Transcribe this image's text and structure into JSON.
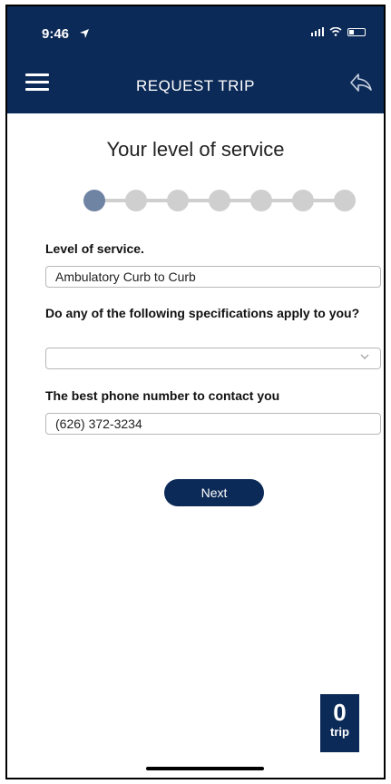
{
  "status_bar": {
    "time": "9:46"
  },
  "header": {
    "title": "REQUEST TRIP"
  },
  "page": {
    "heading": "Your level of service"
  },
  "stepper": {
    "total_steps": 7,
    "current_step": 1
  },
  "form": {
    "level_of_service_label": "Level of service.",
    "level_of_service_value": "Ambulatory Curb to Curb",
    "specifications_label": "Do any of the following specifications apply to you?",
    "specifications_value": "",
    "phone_label": "The best phone number to contact you",
    "phone_value": "(626) 372-3234"
  },
  "actions": {
    "next_label": "Next"
  },
  "trip_badge": {
    "count": "0",
    "label": "trip"
  },
  "colors": {
    "navy": "#0c2a57",
    "active_step": "#6f83a3",
    "inactive_step": "#cfcfcf"
  }
}
